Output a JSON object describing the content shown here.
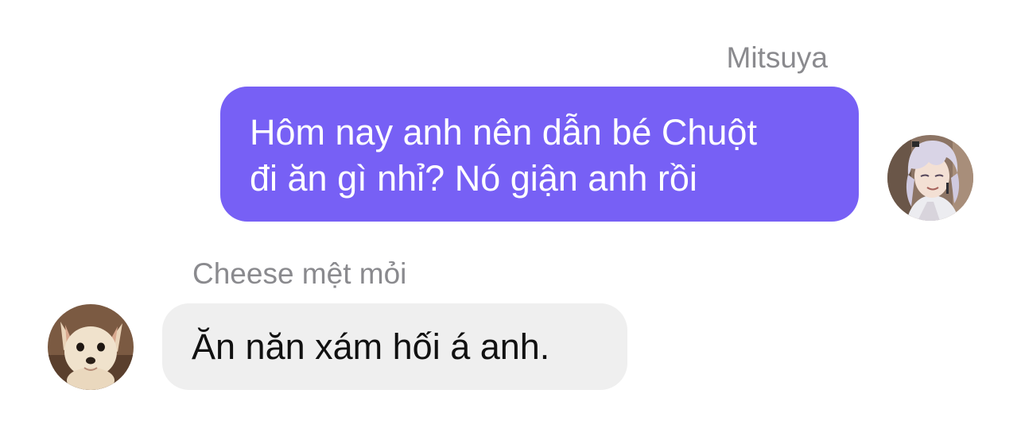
{
  "conversation": {
    "outgoing": {
      "sender": "Mitsuya",
      "lines": [
        "Hôm nay anh nên dẫn bé Chuột",
        "đi ăn gì nhỉ? Nó giận anh rồi"
      ],
      "avatar_icon": "anime-boy-avatar-icon",
      "bubble_color": "#7760f5"
    },
    "incoming": {
      "sender": "Cheese mệt mỏi",
      "lines": [
        "Ăn năn xám hối á anh."
      ],
      "avatar_icon": "chihuahua-avatar-icon",
      "bubble_color": "#efefef"
    }
  }
}
